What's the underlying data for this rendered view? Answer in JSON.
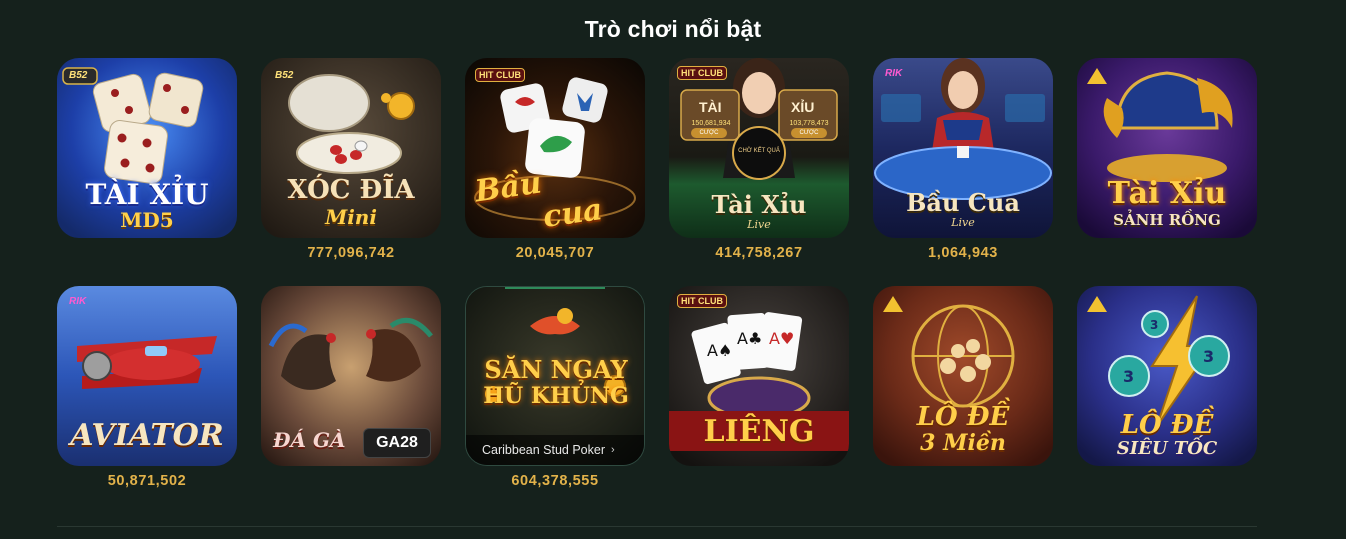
{
  "section": {
    "title": "Trò chơi nổi bật"
  },
  "games_row1": [
    {
      "title_line1": "TÀI XỈU",
      "title_line2": "MD5",
      "brand": "B52",
      "jackpot": ""
    },
    {
      "title_line1": "XÓC ĐĨA",
      "title_line2": "Mini",
      "brand": "B52",
      "jackpot": "777,096,742"
    },
    {
      "title_line1": "Bầu",
      "title_line2": "cua",
      "brand": "HIT CLUB",
      "jackpot": "20,045,707"
    },
    {
      "title_line1": "Tài Xỉu",
      "title_line2": "Live",
      "brand": "HIT CLUB",
      "jackpot": "414,758,267",
      "live_labels": {
        "left": "TÀI",
        "right": "XỈU",
        "left_amount": "150,681,934",
        "right_amount": "103,778,473",
        "bet_label": "CƯỢC",
        "center": "CHỜ KẾT QUẢ"
      }
    },
    {
      "title_line1": "Bầu Cua",
      "title_line2": "Live",
      "brand": "RIK",
      "jackpot": "1,064,943"
    },
    {
      "title_line1": "Tài Xỉu",
      "title_line2": "SẢNH RỒNG",
      "brand": "",
      "jackpot": ""
    }
  ],
  "games_row2": [
    {
      "title_line1": "AVIATOR",
      "title_line2": "",
      "brand": "RIK",
      "jackpot": "50,871,502"
    },
    {
      "title_line1": "ĐÁ GÀ",
      "title_line2": "GA28",
      "brand": "",
      "jackpot": ""
    },
    {
      "title_line1": "SĂN NGAY",
      "title_line2": "HŨ KHỦNG",
      "caption": "Caribbean Stud Poker",
      "chevron": "›",
      "jackpot": "604,378,555"
    },
    {
      "title_line1": "LIÊNG",
      "title_line2": "",
      "brand": "HIT CLUB",
      "jackpot": ""
    },
    {
      "title_line1": "LÔ ĐỀ",
      "title_line2": "3 Miền",
      "brand": "",
      "jackpot": ""
    },
    {
      "title_line1": "LÔ ĐỀ",
      "title_line2": "SIÊU TỐC",
      "brand": "",
      "jackpot": ""
    }
  ],
  "colors": {
    "background": "#15211c",
    "jackpot": "#e2b24a",
    "title": "#ffffff"
  },
  "icons": [
    "dice-icon",
    "plate-icon",
    "shrimp-dice-icon",
    "dealer-icon",
    "dealer-icon",
    "dragon-icon",
    "airplane-icon",
    "rooster-icon",
    "money-bag-icon",
    "cards-icon",
    "lottery-cage-icon",
    "lottery-balls-icon"
  ]
}
